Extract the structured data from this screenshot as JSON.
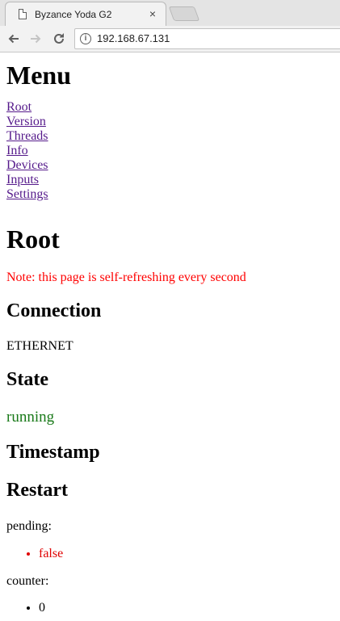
{
  "browser": {
    "tab_title": "Byzance Yoda G2",
    "tab_close": "×",
    "url": "192.168.67.131"
  },
  "menu": {
    "heading": "Menu",
    "links": [
      "Root",
      "Version",
      "Threads",
      "Info",
      "Devices",
      "Inputs",
      "Settings"
    ]
  },
  "root": {
    "heading": "Root",
    "note": "Note: this page is self-refreshing every second"
  },
  "connection": {
    "heading": "Connection",
    "value": "ETHERNET"
  },
  "state": {
    "heading": "State",
    "value": "running"
  },
  "timestamp": {
    "heading": "Timestamp"
  },
  "restart": {
    "heading": "Restart",
    "pending_label": "pending:",
    "pending_value": "false",
    "counter_label": "counter:",
    "counter_value": "0"
  },
  "colors": {
    "note": "#ff0000",
    "state_running": "#1a7a1a",
    "pending_false": "#e00000",
    "visited_link": "#551a8b"
  }
}
